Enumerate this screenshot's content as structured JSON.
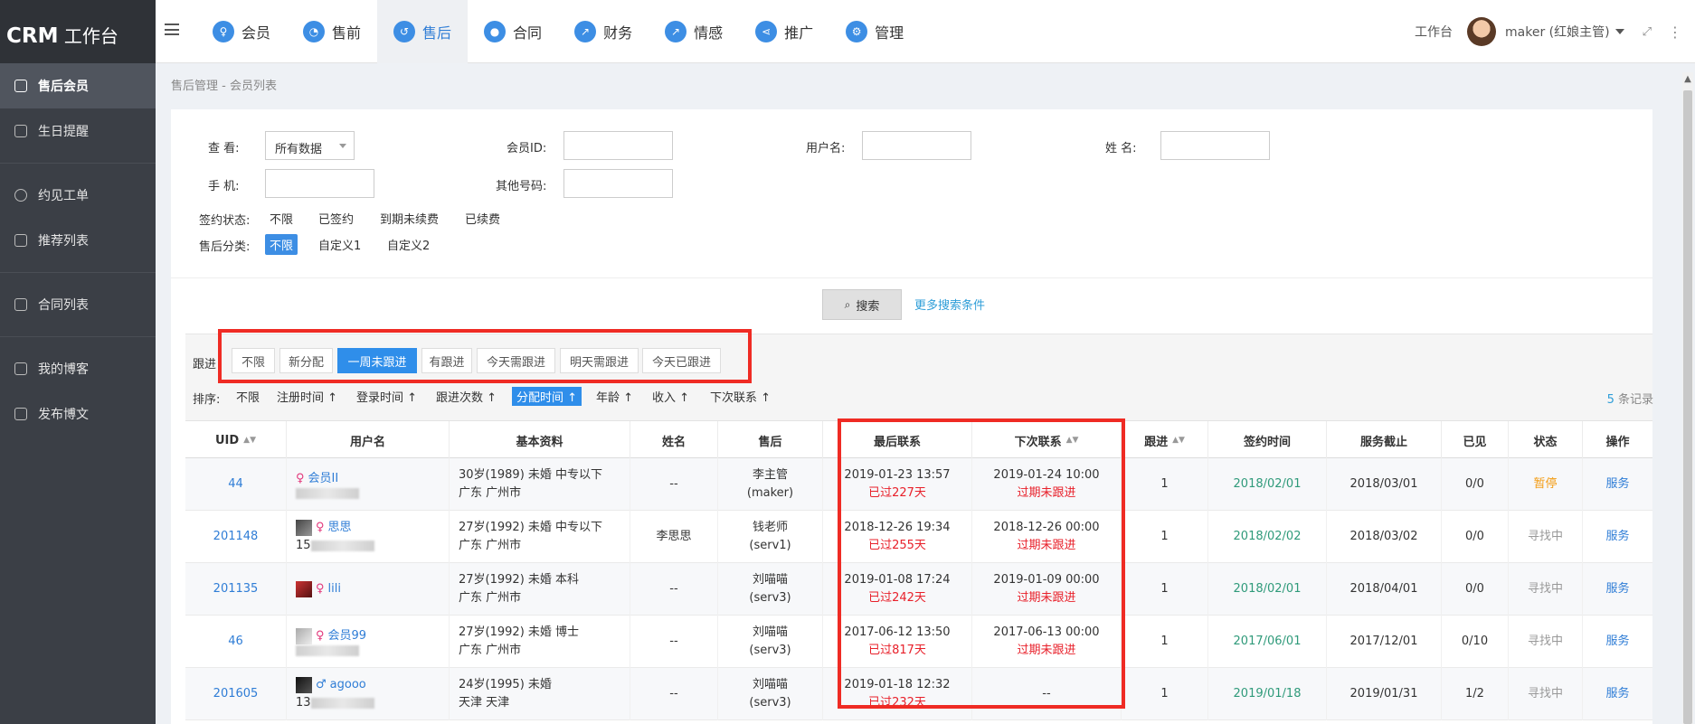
{
  "app": {
    "logo_main": "CRM",
    "logo_sub": " 工作台"
  },
  "sidebar": {
    "items": [
      {
        "label": "售后会员",
        "icon": "user-icon"
      },
      {
        "label": "生日提醒",
        "icon": "cake-icon"
      },
      {
        "label": "约见工单",
        "icon": "heart-icon"
      },
      {
        "label": "推荐列表",
        "icon": "link-icon"
      },
      {
        "label": "合同列表",
        "icon": "document-icon"
      },
      {
        "label": "我的博客",
        "icon": "document-icon"
      },
      {
        "label": "发布博文",
        "icon": "edit-icon"
      }
    ]
  },
  "topnav": {
    "items": [
      {
        "label": "会员",
        "icon": "members-icon"
      },
      {
        "label": "售前",
        "icon": "presale-icon"
      },
      {
        "label": "售后",
        "icon": "aftersale-icon"
      },
      {
        "label": "合同",
        "icon": "contract-icon"
      },
      {
        "label": "财务",
        "icon": "finance-icon"
      },
      {
        "label": "情感",
        "icon": "emotion-icon"
      },
      {
        "label": "推广",
        "icon": "share-icon"
      },
      {
        "label": "管理",
        "icon": "gear-icon"
      }
    ],
    "workbench": "工作台",
    "user": "maker (红娘主管)"
  },
  "breadcrumb": "售后管理 - 会员列表",
  "filters": {
    "view_label": "查  看:",
    "view_value": "所有数据",
    "member_id_label": "会员ID:",
    "username_label": "用户名:",
    "name_label": "姓  名:",
    "phone_label": "手  机:",
    "other_label": "其他号码:",
    "sign_label": "签约状态:",
    "sign_options": [
      "不限",
      "已签约",
      "到期未续费",
      "已续费"
    ],
    "category_label": "售后分类:",
    "category_options": [
      "不限",
      "自定义1",
      "自定义2"
    ],
    "search_btn": "搜索",
    "more": "更多搜索条件"
  },
  "followup": {
    "label": "跟进",
    "tabs": [
      "不限",
      "新分配",
      "一周未跟进",
      "有跟进",
      "今天需跟进",
      "明天需跟进",
      "今天已跟进"
    ]
  },
  "sort": {
    "label": "排序:",
    "items": [
      "不限",
      "注册时间 ↑",
      "登录时间 ↑",
      "跟进次数 ↑",
      "分配时间 ↑",
      "年龄 ↑",
      "收入 ↑",
      "下次联系 ↑"
    ]
  },
  "records": {
    "count": "5",
    "suffix": " 条记录"
  },
  "table": {
    "headers": [
      "UID",
      "用户名",
      "基本资料",
      "姓名",
      "售后",
      "最后联系",
      "下次联系",
      "跟进",
      "签约时间",
      "服务截止",
      "已见",
      "状态",
      "操作"
    ],
    "rows": [
      {
        "uid": "44",
        "name": "会员II",
        "phone": "",
        "info1": "30岁(1989) 未婚 中专以下",
        "info2": "广东 广州市",
        "realname": "--",
        "after1": "李主管",
        "after2": "(maker)",
        "last1": "2019-01-23 13:57",
        "last2": "已过227天",
        "next1": "2019-01-24 10:00",
        "next2": "过期未跟进",
        "follow": "1",
        "sign": "2018/02/01",
        "end": "2018/03/01",
        "seen": "0/0",
        "status": "暂停",
        "op": "服务"
      },
      {
        "uid": "201148",
        "name": "思思",
        "phone": "15",
        "info1": "27岁(1992) 未婚 中专以下",
        "info2": "广东 广州市",
        "realname": "李思思",
        "after1": "钱老师",
        "after2": "(serv1)",
        "last1": "2018-12-26 19:34",
        "last2": "已过255天",
        "next1": "2018-12-26 00:00",
        "next2": "过期未跟进",
        "follow": "1",
        "sign": "2018/02/02",
        "end": "2018/03/02",
        "seen": "0/0",
        "status": "寻找中",
        "op": "服务"
      },
      {
        "uid": "201135",
        "name": "lili",
        "phone": "",
        "info1": "27岁(1992) 未婚 本科",
        "info2": "广东 广州市",
        "realname": "--",
        "after1": "刘喵喵",
        "after2": "(serv3)",
        "last1": "2019-01-08 17:24",
        "last2": "已过242天",
        "next1": "2019-01-09 00:00",
        "next2": "过期未跟进",
        "follow": "1",
        "sign": "2018/02/01",
        "end": "2018/04/01",
        "seen": "0/0",
        "status": "寻找中",
        "op": "服务"
      },
      {
        "uid": "46",
        "name": "会员99",
        "phone": "",
        "info1": "27岁(1992) 未婚 博士",
        "info2": "广东 广州市",
        "realname": "--",
        "after1": "刘喵喵",
        "after2": "(serv3)",
        "last1": "2017-06-12 13:50",
        "last2": "已过817天",
        "next1": "2017-06-13 00:00",
        "next2": "过期未跟进",
        "follow": "1",
        "sign": "2017/06/01",
        "end": "2017/12/01",
        "seen": "0/10",
        "status": "寻找中",
        "op": "服务"
      },
      {
        "uid": "201605",
        "name": "agooo",
        "phone": "13",
        "info1": "24岁(1995) 未婚",
        "info2": "天津 天津",
        "realname": "--",
        "after1": "刘喵喵",
        "after2": "(serv3)",
        "last1": "2019-01-18 12:32",
        "last2": "已过232天",
        "next1": "--",
        "next2": "",
        "follow": "1",
        "sign": "2019/01/18",
        "end": "2019/01/31",
        "seen": "1/2",
        "status": "寻找中",
        "op": "服务"
      }
    ]
  },
  "colors": {
    "accent": "#2f8eea",
    "highlight": "#ef2b24",
    "sidebar": "#3b3f46"
  }
}
